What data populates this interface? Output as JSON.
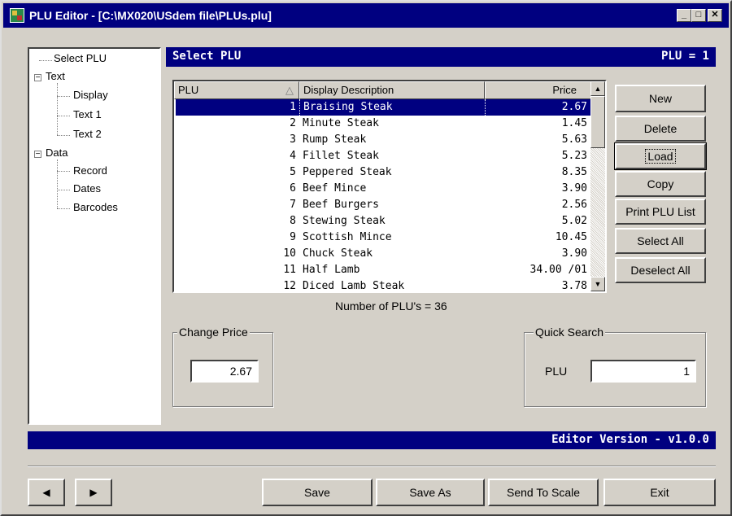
{
  "window": {
    "title": "PLU Editor - [C:\\MX020\\USdem file\\PLUs.plu]",
    "controls": {
      "minimize": "_",
      "maximize": "□",
      "close": "✕"
    }
  },
  "tree": {
    "select_plu": "Select PLU",
    "text": "Text",
    "display": "Display",
    "text1": "Text 1",
    "text2": "Text 2",
    "data": "Data",
    "record": "Record",
    "dates": "Dates",
    "barcodes": "Barcodes",
    "expander_text": "−",
    "expander_data": "−"
  },
  "header": {
    "section_title": "Select PLU",
    "plu_indicator": "PLU = 1"
  },
  "table": {
    "columns": [
      "PLU",
      "Display Description",
      "Price"
    ],
    "sort_glyph": "△",
    "rows": [
      {
        "plu": "1",
        "desc": "Braising Steak",
        "price": "2.67"
      },
      {
        "plu": "2",
        "desc": "Minute Steak",
        "price": "1.45"
      },
      {
        "plu": "3",
        "desc": "Rump Steak",
        "price": "5.63"
      },
      {
        "plu": "4",
        "desc": "Fillet Steak",
        "price": "5.23"
      },
      {
        "plu": "5",
        "desc": "Peppered Steak",
        "price": "8.35"
      },
      {
        "plu": "6",
        "desc": "Beef Mince",
        "price": "3.90"
      },
      {
        "plu": "7",
        "desc": "Beef Burgers",
        "price": "2.56"
      },
      {
        "plu": "8",
        "desc": "Stewing Steak",
        "price": "5.02"
      },
      {
        "plu": "9",
        "desc": "Scottish Mince",
        "price": "10.45"
      },
      {
        "plu": "10",
        "desc": "Chuck Steak",
        "price": "3.90"
      },
      {
        "plu": "11",
        "desc": "Half Lamb",
        "price": "34.00 /01"
      },
      {
        "plu": "12",
        "desc": "Diced Lamb Steak",
        "price": "3.78"
      }
    ],
    "scroll_up": "▲",
    "scroll_down": "▼"
  },
  "count_label": "Number of PLU's = 36",
  "buttons": {
    "new": "New",
    "delete": "Delete",
    "load": "Load",
    "copy": "Copy",
    "print": "Print PLU List",
    "select_all": "Select All",
    "deselect_all": "Deselect All"
  },
  "change_price": {
    "legend": "Change Price",
    "value": "2.67"
  },
  "quick_search": {
    "legend": "Quick Search",
    "label": "PLU",
    "value": "1"
  },
  "footer": {
    "version": "Editor Version - v1.0.0"
  },
  "bottom": {
    "prev": "◀",
    "next": "▶",
    "save": "Save",
    "save_as": "Save As",
    "send": "Send To Scale",
    "exit": "Exit"
  },
  "colors": {
    "title_bg": "#000080",
    "selection": "#000080",
    "face": "#d4d0c8"
  }
}
